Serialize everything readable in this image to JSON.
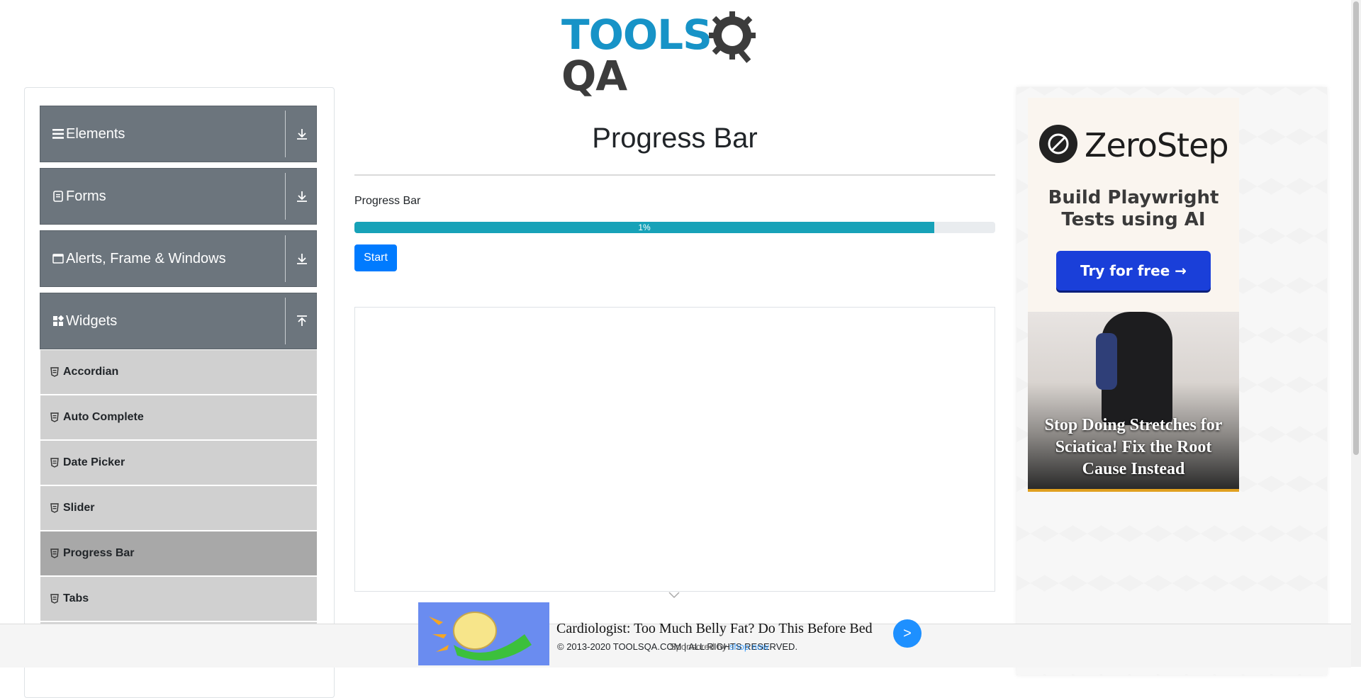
{
  "header": {
    "logo_text_tools": "TOOLS",
    "logo_text_qa": "QA"
  },
  "sidebar": {
    "groups": [
      {
        "title": "Elements",
        "icon": "hamburger-icon",
        "state": "collapsed"
      },
      {
        "title": "Forms",
        "icon": "document-icon",
        "state": "collapsed"
      },
      {
        "title": "Alerts, Frame & Windows",
        "icon": "window-icon",
        "state": "collapsed"
      },
      {
        "title": "Widgets",
        "icon": "widgets-icon",
        "state": "expanded"
      }
    ],
    "items": [
      {
        "label": "Accordian"
      },
      {
        "label": "Auto Complete"
      },
      {
        "label": "Date Picker"
      },
      {
        "label": "Slider"
      },
      {
        "label": "Progress Bar",
        "active": true
      },
      {
        "label": "Tabs"
      }
    ]
  },
  "main": {
    "title": "Progress Bar",
    "progress_label": "Progress Bar",
    "progress_value_text": "1%",
    "progress_fill_fraction": 0.905,
    "start_label": "Start",
    "colors": {
      "fill": "#17a2b8",
      "button": "#007bff"
    }
  },
  "right_ads": {
    "zerostep": {
      "brand": "ZeroStep",
      "tagline_1": "Build Playwright",
      "tagline_2": "Tests using AI",
      "button": "Try for free →"
    },
    "stretch": {
      "headline": "Stop Doing Stretches for Sciatica! Fix the Root Cause Instead"
    }
  },
  "bottom_ad": {
    "headline": "Cardiologist: Too Much Belly Fat? Do This Before Bed",
    "button": ">"
  },
  "footer": {
    "copyright": "© 2013-2020 TOOLSQA.COM | ALL RIGHTS RESERVED.",
    "sponsored_prefix": "Sponsored by",
    "sponsored_link": "shop now"
  }
}
